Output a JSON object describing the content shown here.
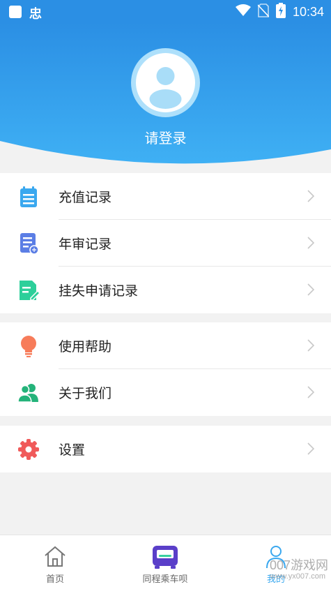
{
  "status_bar": {
    "time": "10:34",
    "left_glyph": "忠",
    "icons": [
      "app-square-icon",
      "wifi-icon",
      "no-sim-icon",
      "battery-charging-icon"
    ]
  },
  "header": {
    "login_text": "请登录",
    "gradient_top": "#2b8fe4",
    "gradient_bottom": "#3fb0f4"
  },
  "menu": {
    "group1": [
      {
        "label": "充值记录",
        "icon": "recharge-record-icon",
        "color": "#3aa8ef"
      },
      {
        "label": "年审记录",
        "icon": "annual-review-icon",
        "color": "#5b7ee5"
      },
      {
        "label": "挂失申请记录",
        "icon": "loss-report-icon",
        "color": "#2dcf9a"
      }
    ],
    "group2": [
      {
        "label": "使用帮助",
        "icon": "lightbulb-icon",
        "color": "#f77c5a"
      },
      {
        "label": "关于我们",
        "icon": "users-icon",
        "color": "#24b37a"
      }
    ],
    "group3": [
      {
        "label": "设置",
        "icon": "settings-gear-icon",
        "color": "#f05a5a"
      }
    ]
  },
  "bottom_nav": [
    {
      "label": "首页",
      "icon": "home-icon"
    },
    {
      "label": "同程乘车呗",
      "icon": "bus-icon"
    },
    {
      "label": "我的",
      "icon": "person-icon"
    }
  ],
  "watermark": {
    "text": "007游戏网",
    "sub": "www.yx007.com"
  }
}
